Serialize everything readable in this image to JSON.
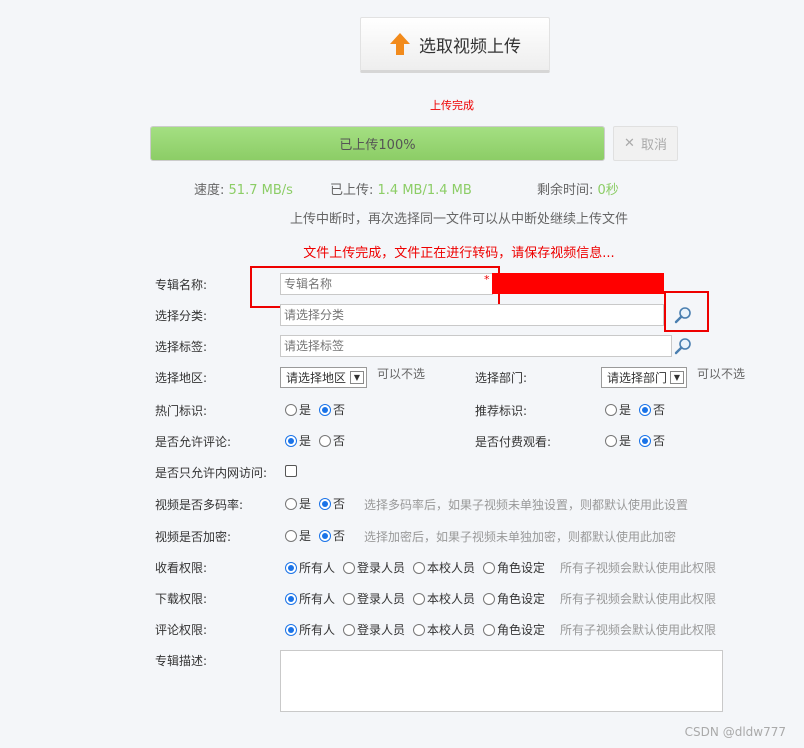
{
  "upload": {
    "button_label": "选取视频上传",
    "status": "上传完成",
    "progress_label": "已上传100%",
    "progress_fraction": 1.0,
    "cancel_label": "取消",
    "speed_label": "速度:",
    "speed_value": "51.7 MB/s",
    "uploaded_label": "已上传:",
    "uploaded_value": "1.4 MB/1.4 MB",
    "remaining_label": "剩余时间:",
    "remaining_value": "0秒",
    "resume_tip": "上传中断时，再次选择同一文件可以从中断处继续上传文件",
    "complete_notice": "文件上传完成，文件正在进行转码，请保存视频信息..."
  },
  "form": {
    "album_name": {
      "label": "专辑名称:",
      "placeholder": "专辑名称",
      "required_mark": "*"
    },
    "category": {
      "label": "选择分类:",
      "placeholder": "请选择分类"
    },
    "tags": {
      "label": "选择标签:",
      "placeholder": "请选择标签"
    },
    "region": {
      "label": "选择地区:",
      "selected": "请选择地区",
      "optional": "可以不选"
    },
    "department": {
      "label": "选择部门:",
      "selected": "请选择部门",
      "optional": "可以不选"
    },
    "hot": {
      "label": "热门标识:",
      "options": [
        "是",
        "否"
      ],
      "selected": 1
    },
    "recommend": {
      "label": "推荐标识:",
      "options": [
        "是",
        "否"
      ],
      "selected": 1
    },
    "allow_comment": {
      "label": "是否允许评论:",
      "options": [
        "是",
        "否"
      ],
      "selected": 0
    },
    "paid": {
      "label": "是否付费观看:",
      "options": [
        "是",
        "否"
      ],
      "selected": 1
    },
    "intranet_only": {
      "label": "是否只允许内网访问:",
      "checked": false
    },
    "multi_bitrate": {
      "label": "视频是否多码率:",
      "options": [
        "是",
        "否"
      ],
      "selected": 1,
      "hint": "选择多码率后，如果子视频未单独设置，则都默认使用此设置"
    },
    "encrypt": {
      "label": "视频是否加密:",
      "options": [
        "是",
        "否"
      ],
      "selected": 1,
      "hint": "选择加密后，如果子视频未单独加密，则都默认使用此加密"
    },
    "view_perm": {
      "label": "收看权限:",
      "options": [
        "所有人",
        "登录人员",
        "本校人员",
        "角色设定"
      ],
      "selected": 0,
      "hint": "所有子视频会默认使用此权限"
    },
    "download_perm": {
      "label": "下载权限:",
      "options": [
        "所有人",
        "登录人员",
        "本校人员",
        "角色设定"
      ],
      "selected": 0,
      "hint": "所有子视频会默认使用此权限"
    },
    "comment_perm": {
      "label": "评论权限:",
      "options": [
        "所有人",
        "登录人员",
        "本校人员",
        "角色设定"
      ],
      "selected": 0,
      "hint": "所有子视频会默认使用此权限"
    },
    "description": {
      "label": "专辑描述:"
    }
  },
  "watermark": "CSDN @dldw777",
  "colors": {
    "accent": "#1a73e8",
    "progress": "#8ccd66",
    "warning": "#ee0000",
    "upload_arrow": "#f28b1c"
  }
}
